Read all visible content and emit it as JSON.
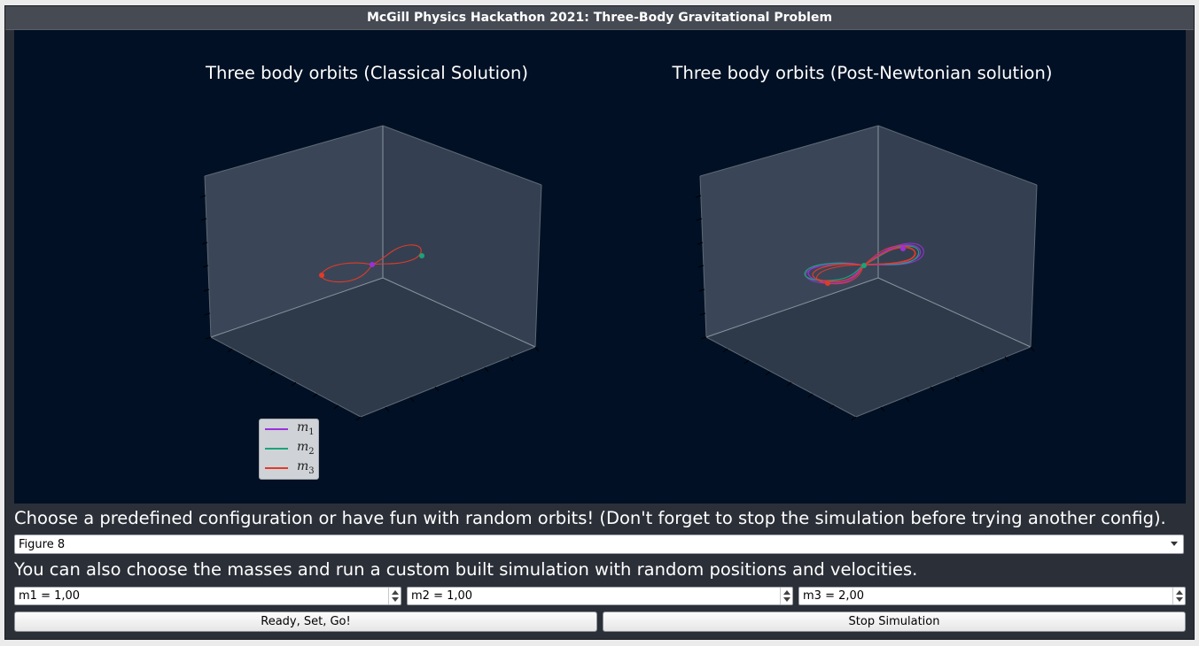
{
  "window": {
    "title": "McGill Physics Hackathon 2021: Three-Body Gravitational Problem"
  },
  "plots": {
    "left_title": "Three body orbits (Classical Solution)",
    "right_title": "Three body orbits (Post-Newtonian solution)",
    "legend": [
      {
        "symbol": "m",
        "sub": "1",
        "color": "#9b30d9"
      },
      {
        "symbol": "m",
        "sub": "2",
        "color": "#1aa37a"
      },
      {
        "symbol": "m",
        "sub": "3",
        "color": "#e23a2a"
      }
    ],
    "colors": {
      "background": "#011024",
      "pane": "#354252",
      "axis": "#8a939e"
    }
  },
  "controls": {
    "config_caption": "Choose a predefined configuration or have fun with random orbits! (Don't forget to stop the simulation before trying another config).",
    "config_selected": "Figure 8",
    "mass_caption": "You can also choose the masses and run a custom built simulation with random positions and velocities.",
    "m1": "m1 =  1,00",
    "m2": "m2 =  1,00",
    "m3": "m3 =  2,00",
    "go_button": "Ready, Set, Go!",
    "stop_button": "Stop Simulation"
  }
}
